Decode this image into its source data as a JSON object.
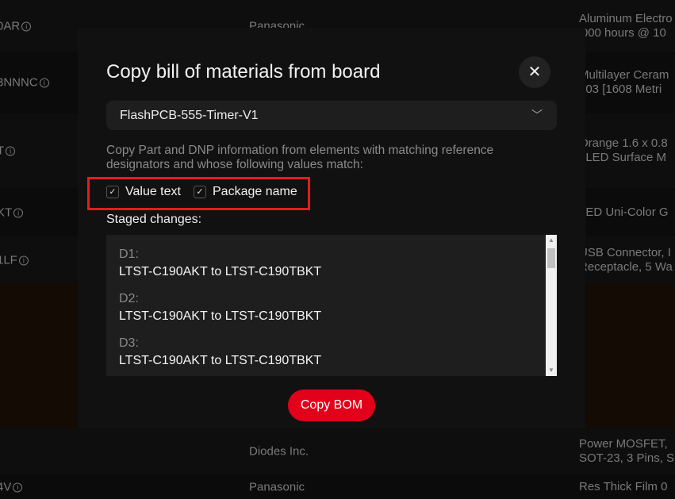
{
  "background_rows": [
    {
      "ref": "0AR",
      "manufacturer": "Panasonic",
      "description": [
        "Aluminum Electro",
        "'000 hours @ 10"
      ]
    },
    {
      "ref": "3NNNC",
      "manufacturer": "",
      "description": [
        "Multilayer Ceram",
        "603 [1608 Metri"
      ]
    },
    {
      "ref": "T",
      "manufacturer": "",
      "description": [
        "Orange 1.6 x 0.8",
        "/ LED Surface M"
      ]
    },
    {
      "ref": "KT",
      "manufacturer": "",
      "description": [
        "LED Uni-Color G",
        ""
      ]
    },
    {
      "ref": "1LF",
      "manufacturer": "",
      "description": [
        "USB Connector, I",
        "Receptacle, 5 Wa"
      ]
    },
    {
      "ref": "",
      "manufacturer": "",
      "description": [
        "",
        ""
      ]
    },
    {
      "ref": "",
      "manufacturer": "Diodes Inc.",
      "description": [
        "Power MOSFET,",
        "SOT-23, 3 Pins, S"
      ]
    },
    {
      "ref": "4V",
      "manufacturer": "Panasonic",
      "description": [
        "Res Thick Film 0",
        ""
      ]
    }
  ],
  "modal": {
    "title": "Copy bill of materials from board",
    "close_icon": "close-icon",
    "board_select": "FlashPCB-555-Timer-V1",
    "description": "Copy Part and DNP information from elements with matching reference designators and whose following values match:",
    "checkboxes": [
      {
        "label": "Value text",
        "checked": true
      },
      {
        "label": "Package name",
        "checked": true
      }
    ],
    "staged_label": "Staged changes:",
    "staged_changes": [
      {
        "ref": "D1:",
        "change": "LTST-C190AKT to LTST-C190TBKT"
      },
      {
        "ref": "D2:",
        "change": "LTST-C190AKT to LTST-C190TBKT"
      },
      {
        "ref": "D3:",
        "change": "LTST-C190AKT to LTST-C190TBKT"
      }
    ],
    "copy_button": "Copy BOM",
    "accent_color": "#e2001a",
    "highlight_color": "#e41b23"
  }
}
